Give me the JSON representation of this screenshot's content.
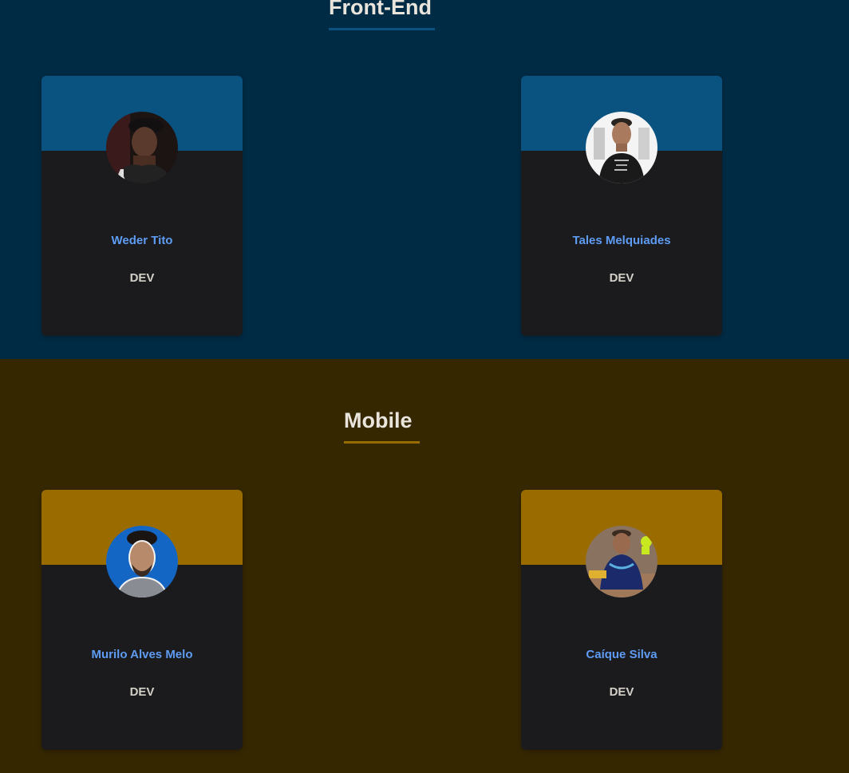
{
  "sections": [
    {
      "title": "Front-End",
      "accent": "#0a5280",
      "members": [
        {
          "name": "Weder Tito",
          "role": "DEV"
        },
        {
          "name": "Tales Melquiades",
          "role": "DEV"
        }
      ]
    },
    {
      "title": "Mobile",
      "accent": "#9a6c00",
      "members": [
        {
          "name": "Murilo Alves Melo",
          "role": "DEV"
        },
        {
          "name": "Caíque Silva",
          "role": "DEV"
        }
      ]
    }
  ],
  "colors": {
    "frontend_bg": "#002b44",
    "mobile_bg": "#352700",
    "card_bg": "#1b1b1e",
    "name_color": "#5e9cf3"
  }
}
